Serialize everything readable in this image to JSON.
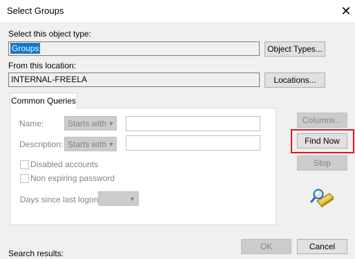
{
  "window": {
    "title": "Select Groups",
    "close_glyph": "✕"
  },
  "object_type": {
    "label": "Select this object type:",
    "value": "Groups",
    "button": "Object Types..."
  },
  "location": {
    "label": "From this location:",
    "value": "INTERNAL-FREELA",
    "button": "Locations..."
  },
  "tabs": [
    {
      "label": "Common Queries"
    }
  ],
  "query": {
    "name_label": "Name:",
    "name_mode": "Starts with",
    "description_label": "Description:",
    "description_mode": "Starts with",
    "disabled_accounts": "Disabled accounts",
    "non_expiring_password": "Non expiring password",
    "days_label": "Days since last logon:",
    "days_value": ""
  },
  "side_buttons": {
    "columns": "Columns...",
    "find_now": "Find Now",
    "stop": "Stop"
  },
  "search_icon": "search-flashlight-icon",
  "results_label": "Search results:",
  "footer": {
    "ok": "OK",
    "cancel": "Cancel"
  },
  "colors": {
    "highlight": "#e0191e",
    "selection": "#0078d7"
  }
}
